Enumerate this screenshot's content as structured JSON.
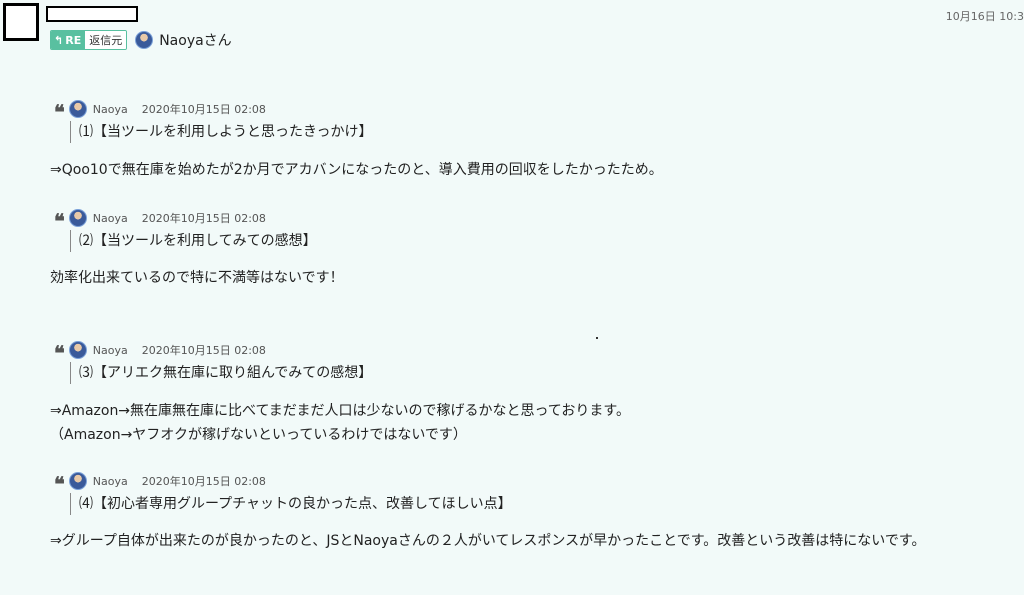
{
  "header": {
    "timestamp": "10月16日 10:3",
    "re_label": "RE",
    "re_source": "返信元",
    "sender_name": "Naoyaさん"
  },
  "quotes": [
    {
      "author": "Naoya",
      "date": "2020年10月15日 02:08",
      "title": "⑴【当ツールを利用しようと思ったきっかけ】",
      "reply": [
        "⇒Qoo10で無在庫を始めたが2か月でアカバンになったのと、導入費用の回収をしたかったため。"
      ]
    },
    {
      "author": "Naoya",
      "date": "2020年10月15日 02:08",
      "title": "⑵【当ツールを利用してみての感想】",
      "reply": [
        "効率化出来ているので特に不満等はないです！"
      ]
    },
    {
      "author": "Naoya",
      "date": "2020年10月15日 02:08",
      "title": "⑶【アリエク無在庫に取り組んでみての感想】",
      "reply": [
        "⇒Amazon→無在庫無在庫に比べてまだまだ人口は少ないので稼げるかなと思っております。",
        "（Amazon→ヤフオクが稼げないといっているわけではないです）"
      ]
    },
    {
      "author": "Naoya",
      "date": "2020年10月15日 02:08",
      "title": "⑷【初心者専用グループチャットの良かった点、改善してほしい点】",
      "reply": [
        "⇒グループ自体が出来たのが良かったのと、JSとNaoyaさんの２人がいてレスポンスが早かったことです。改善という改善は特にないです。"
      ]
    }
  ]
}
